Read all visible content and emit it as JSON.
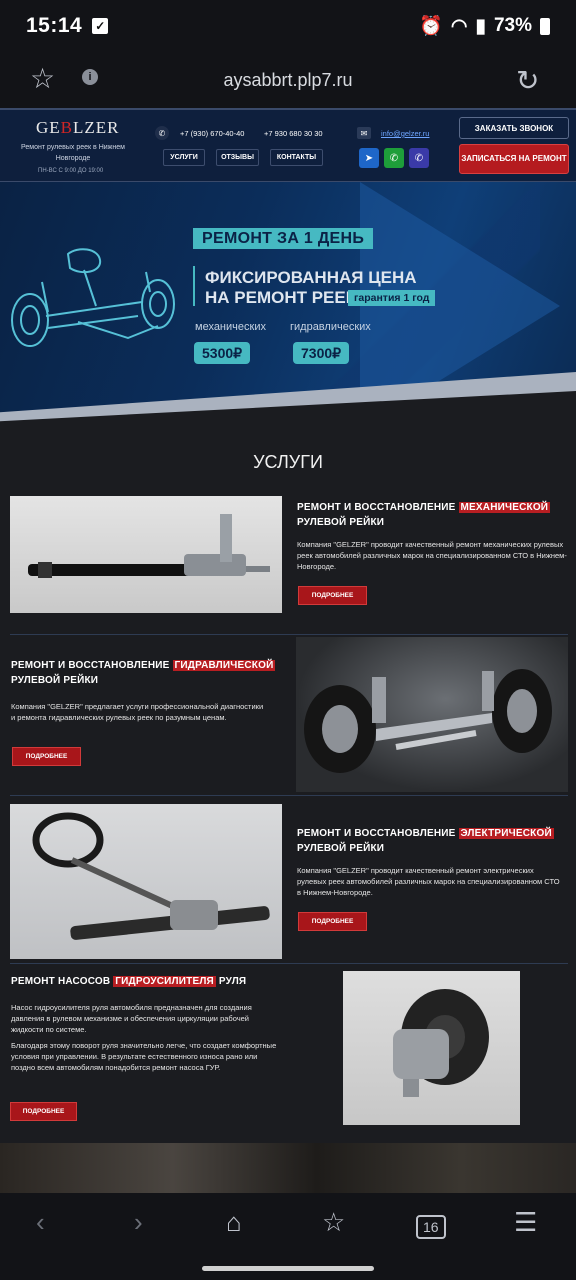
{
  "status": {
    "time": "15:14",
    "battery": "73%"
  },
  "browser": {
    "url": "aysabbrt.plp7.ru",
    "tabs_count": "16"
  },
  "header": {
    "logo": {
      "pre": "GE",
      "accent": "B",
      "post": "LZER"
    },
    "tagline": "Ремонт рулевых реек в Нижнем Новгороде",
    "hours": "ПН-ВС С 9:00 ДО 19:00",
    "phone1": "+7 (930) 670-40-40",
    "phone2": "+7 930 680 30 30",
    "email": "info@gelzer.ru",
    "nav": [
      "УСЛУГИ",
      "ОТЗЫВЫ",
      "КОНТАКТЫ"
    ],
    "call_button": "ЗАКАЗАТЬ ЗВОНОК",
    "signup_button": "ЗАПИСАТЬСЯ НА РЕМОНТ"
  },
  "hero": {
    "badge": "РЕМОНТ ЗА 1 ДЕНЬ",
    "line1": "ФИКСИРОВАННАЯ ЦЕНА",
    "line2": "НА РЕМОНТ РЕЕК",
    "guarantee": "гарантия 1 год",
    "label_mech": "механических",
    "label_hyd": "гидравлических",
    "price_mech": "5300₽",
    "price_hyd": "7300₽"
  },
  "services": {
    "title": "УСЛУГИ",
    "more_label": "ПОДРОБНЕЕ",
    "items": [
      {
        "title_pre": "РЕМОНТ И ВОССТАНОВЛЕНИЕ ",
        "title_hl": "МЕХАНИЧЕСКОЙ",
        "title_post": "РУЛЕВОЙ РЕЙКИ",
        "text": "Компания \"GELZER\"  проводит качественный ремонт механических рулевых реек автомобилей различных марок на специализированном СТО в Нижнем-Новгороде."
      },
      {
        "title_pre": "РЕМОНТ И ВОССТАНОВЛЕНИЕ ",
        "title_hl": "ГИДРАВЛИЧЕСКОЙ",
        "title_post": "РУЛЕВОЙ РЕЙКИ",
        "text": "Компания \"GELZER\" предлагает услуги профессиональной диагностики и ремонта гидравлических рулевых реек по разумным ценам."
      },
      {
        "title_pre": "РЕМОНТ И ВОССТАНОВЛЕНИЕ ",
        "title_hl": "ЭЛЕКТРИЧЕСКОЙ",
        "title_post": "РУЛЕВОЙ РЕЙКИ",
        "text": "Компания \"GELZER\"  проводит качественный ремонт электрических рулевых реек автомобилей различных марок на специализированном СТО в Нижнем-Новгороде."
      },
      {
        "title_pre": "РЕМОНТ НАСОСОВ ",
        "title_hl": "ГИДРОУСИЛИТЕЛЯ",
        "title_post": " РУЛЯ",
        "text": "Насос гидроусилителя руля автомобиля предназначен для создания давления в рулевом механизме и обеспечения циркуляции рабочей жидкости по системе.",
        "text2": "Благодаря этому поворот руля значительно легче, что создает комфортные условия при управлении. В результате естественного износа рано или поздно всем автомобилям понадобится ремонт насоса ГУР."
      }
    ]
  }
}
